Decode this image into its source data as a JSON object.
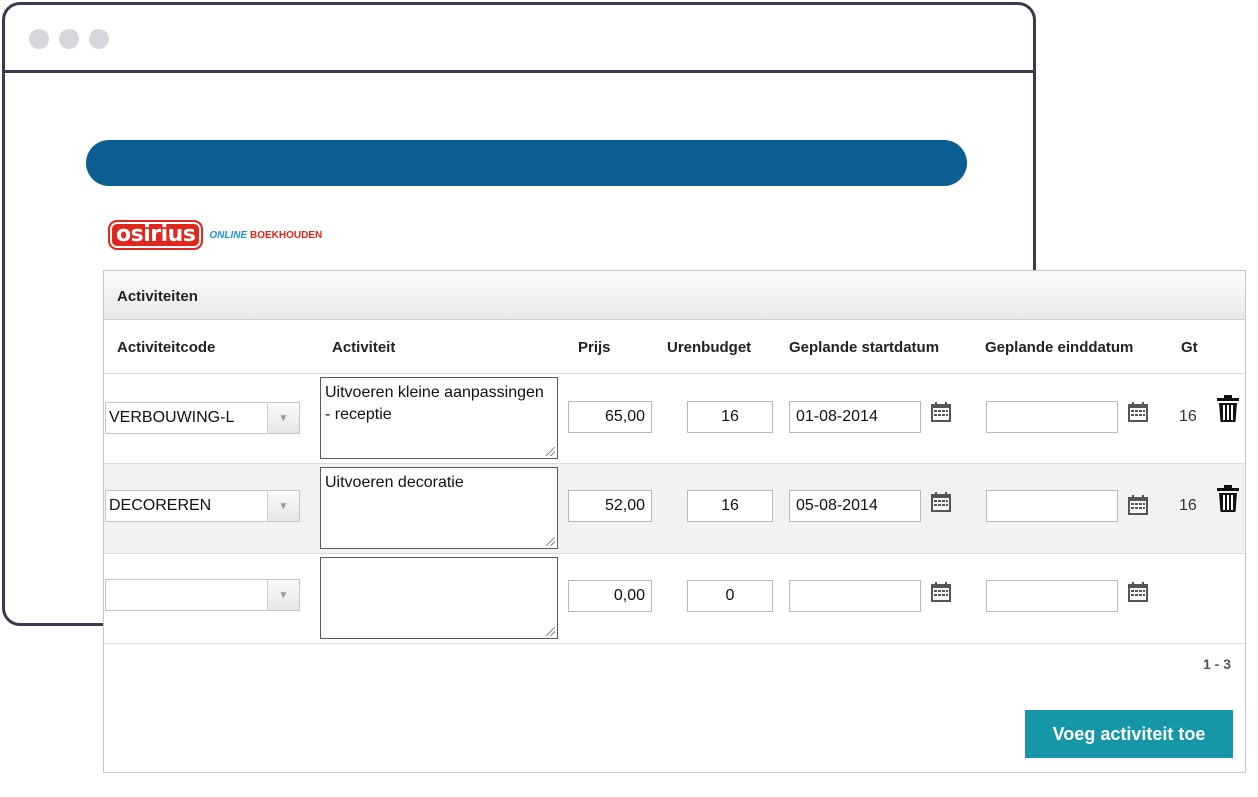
{
  "logo": {
    "mark": "osirius",
    "sub_1": "ONLINE",
    "sub_2": "BOEKHOUDEN",
    "brand_red": "#e1261c",
    "brand_blue": "#1e93d3"
  },
  "header_bar_color": "#0a5e91",
  "panel": {
    "title": "Activiteiten",
    "columns": [
      "Activiteitcode",
      "Activiteit",
      "Prijs",
      "Urenbudget",
      "Geplande startdatum",
      "Geplande einddatum",
      "Gt"
    ],
    "rows": [
      {
        "code": "VERBOUWING-L",
        "activity": "Uitvoeren kleine aanpassingen - receptie",
        "price": "65,00",
        "hours": "16",
        "start": "01-08-2014",
        "end": "",
        "gt": "16"
      },
      {
        "code": "DECOREREN",
        "activity": "Uitvoeren decoratie",
        "price": "52,00",
        "hours": "16",
        "start": "05-08-2014",
        "end": "",
        "gt": "16"
      },
      {
        "code": "",
        "activity": "",
        "price": "0,00",
        "hours": "0",
        "start": "",
        "end": "",
        "gt": ""
      }
    ],
    "pager": "1 - 3",
    "add_button": "Voeg activiteit toe",
    "add_button_color": "#1597a8"
  }
}
